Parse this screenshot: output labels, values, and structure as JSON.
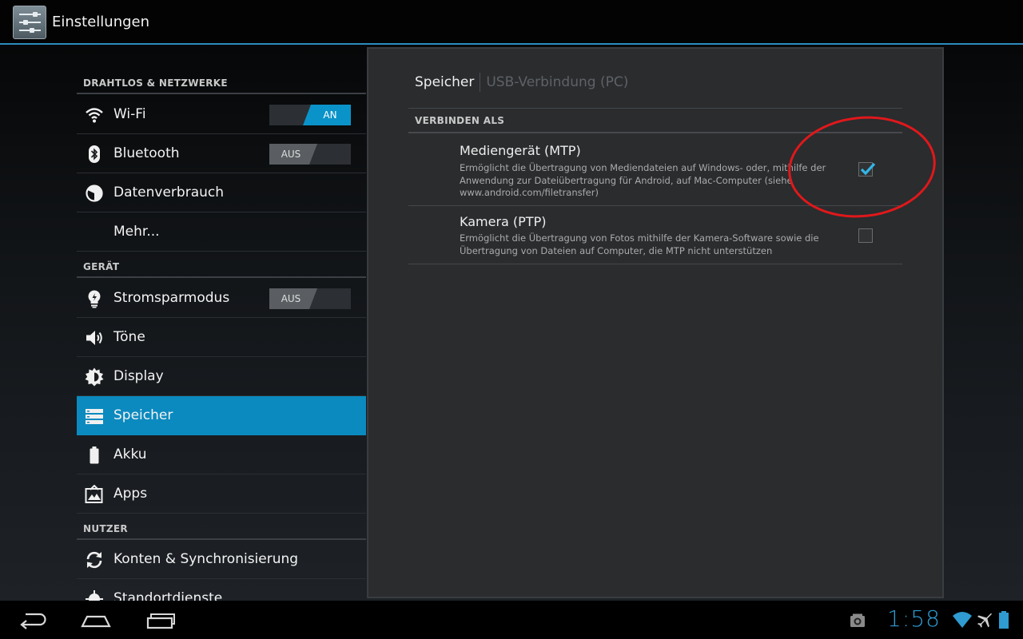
{
  "header": {
    "title": "Einstellungen",
    "app_icon": "settings-icon"
  },
  "sidebar": {
    "sections": [
      {
        "label": "DRAHTLOS & NETZWERKE"
      },
      {
        "label": "GERÄT"
      },
      {
        "label": "NUTZER"
      }
    ],
    "items": [
      {
        "label": "Wi-Fi",
        "icon": "wifi-icon",
        "toggle": "AN",
        "toggle_state": "on"
      },
      {
        "label": "Bluetooth",
        "icon": "bluetooth-icon",
        "toggle": "AUS",
        "toggle_state": "off"
      },
      {
        "label": "Datenverbrauch",
        "icon": "data-usage-icon"
      },
      {
        "label": "Mehr..."
      },
      {
        "label": "Stromsparmodus",
        "icon": "power-saving-icon",
        "toggle": "AUS",
        "toggle_state": "off"
      },
      {
        "label": "Töne",
        "icon": "sound-icon"
      },
      {
        "label": "Display",
        "icon": "display-icon"
      },
      {
        "label": "Speicher",
        "icon": "storage-icon",
        "selected": true
      },
      {
        "label": "Akku",
        "icon": "battery-icon"
      },
      {
        "label": "Apps",
        "icon": "apps-icon"
      },
      {
        "label": "Konten & Synchronisierung",
        "icon": "sync-icon"
      },
      {
        "label": "Standortdienste",
        "icon": "location-icon"
      }
    ]
  },
  "main": {
    "tabs": [
      {
        "label": "Speicher",
        "active": true
      },
      {
        "label": "USB-Verbindung (PC)",
        "active": false
      }
    ],
    "section_header": "VERBINDEN ALS",
    "options": [
      {
        "title": "Mediengerät (MTP)",
        "summary": "Ermöglicht die Übertragung von Mediendateien auf Windows- oder, mithilfe der Anwendung zur Dateiübertragung für Android, auf Mac-Computer (siehe www.android.com/filetransfer)",
        "checked": true
      },
      {
        "title": "Kamera (PTP)",
        "summary": "Ermöglicht die Übertragung von Fotos mithilfe der Kamera-Software sowie die Übertragung von Dateien auf Computer, die MTP nicht unterstützen",
        "checked": false
      }
    ]
  },
  "navbar": {
    "buttons": [
      "back-icon",
      "home-icon",
      "recent-apps-icon"
    ],
    "status": {
      "time": "1:58",
      "icons": [
        "screenshot-icon",
        "wifi-signal-icon",
        "airplane-mode-icon",
        "battery-status-icon"
      ]
    }
  },
  "colors": {
    "accent": "#0b8abf",
    "selected_item": "#0b8abf",
    "clock": "#2f9bd0",
    "annotation": "#e0181b"
  }
}
